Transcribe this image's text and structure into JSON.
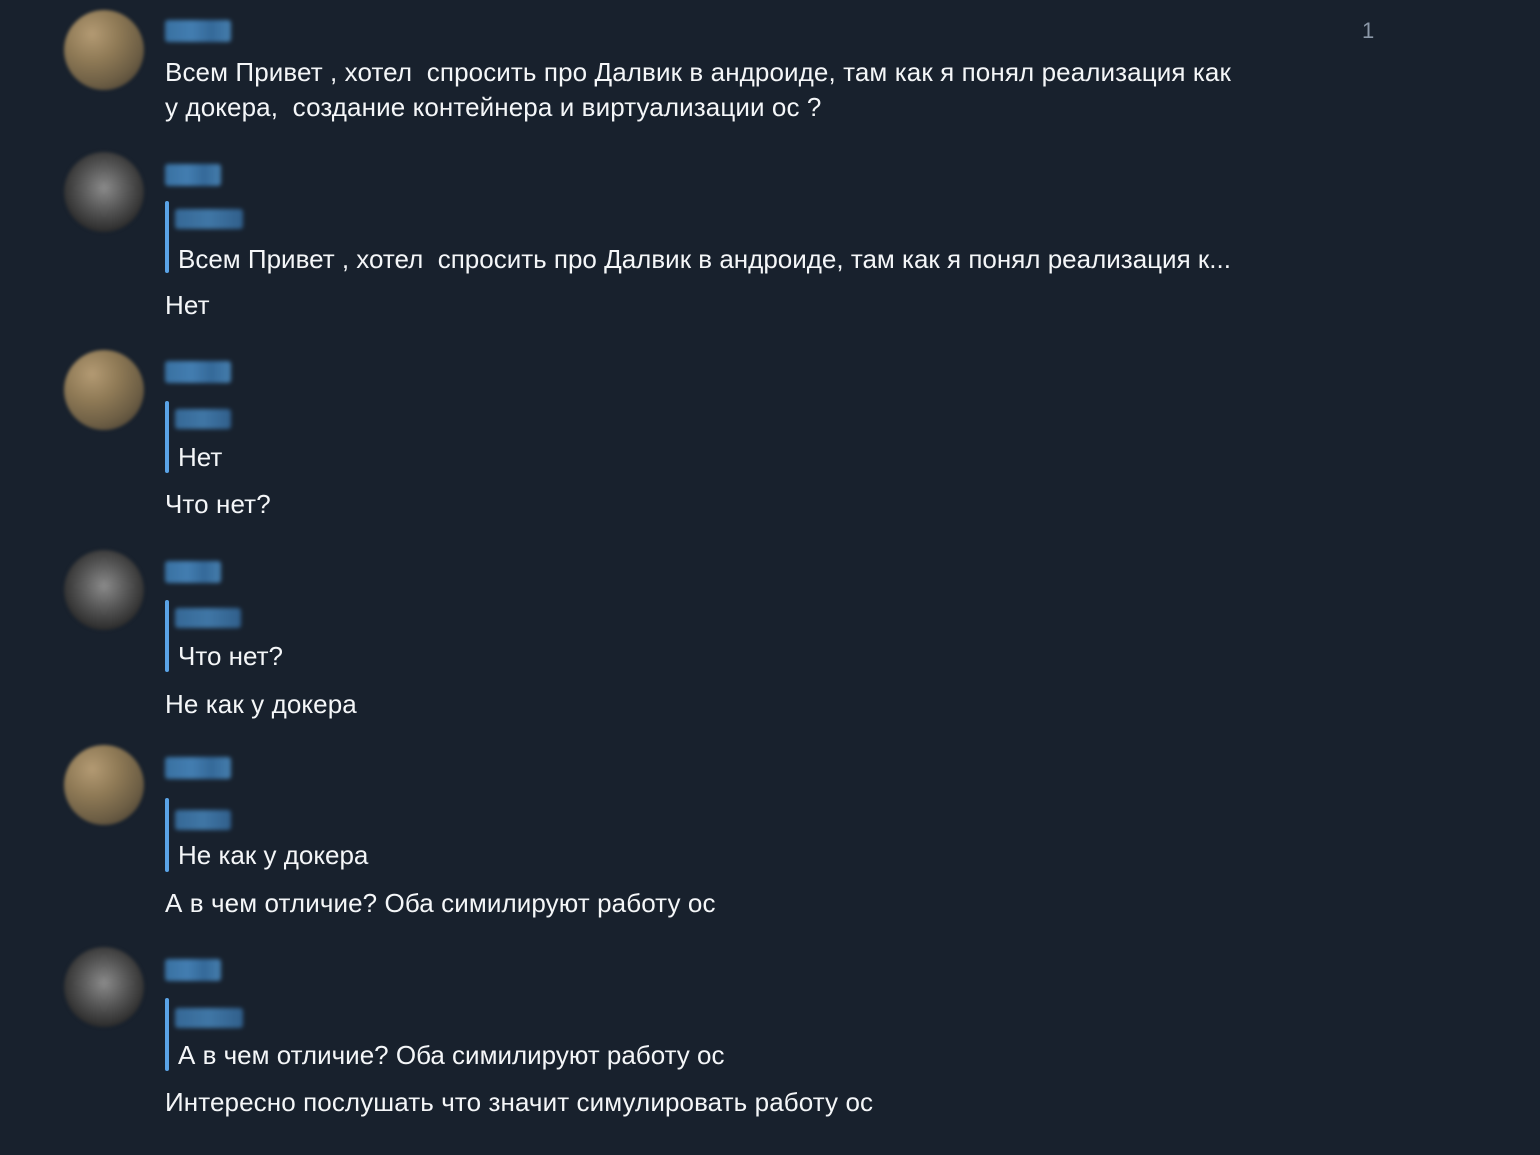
{
  "messages": [
    {
      "text_lines": [
        "Всем Привет , хотел  спросить про Далвик в андроиде, там как я понял реализация как",
        "у докера,  создание контейнера и виртуализации ос ?"
      ],
      "counter": "1"
    },
    {
      "quote": "Всем Привет , хотел  спросить про Далвик в андроиде, там как я понял реализация к...",
      "text": "Нет"
    },
    {
      "quote": "Нет",
      "text": "Что нет?"
    },
    {
      "quote": "Что нет?",
      "text": "Не как у докера"
    },
    {
      "quote": "Не как у докера",
      "text": "А в чем отличие? Оба симилируют работу ос"
    },
    {
      "quote": "А в чем отличие? Оба симилируют работу ос",
      "text": "Интересно послушать что значит симулировать работу ос"
    }
  ],
  "colors": {
    "background": "#18212d",
    "quote_bar": "#5aa3e6",
    "name_blur": "#4b8ec8",
    "text": "#f4f6f8"
  }
}
